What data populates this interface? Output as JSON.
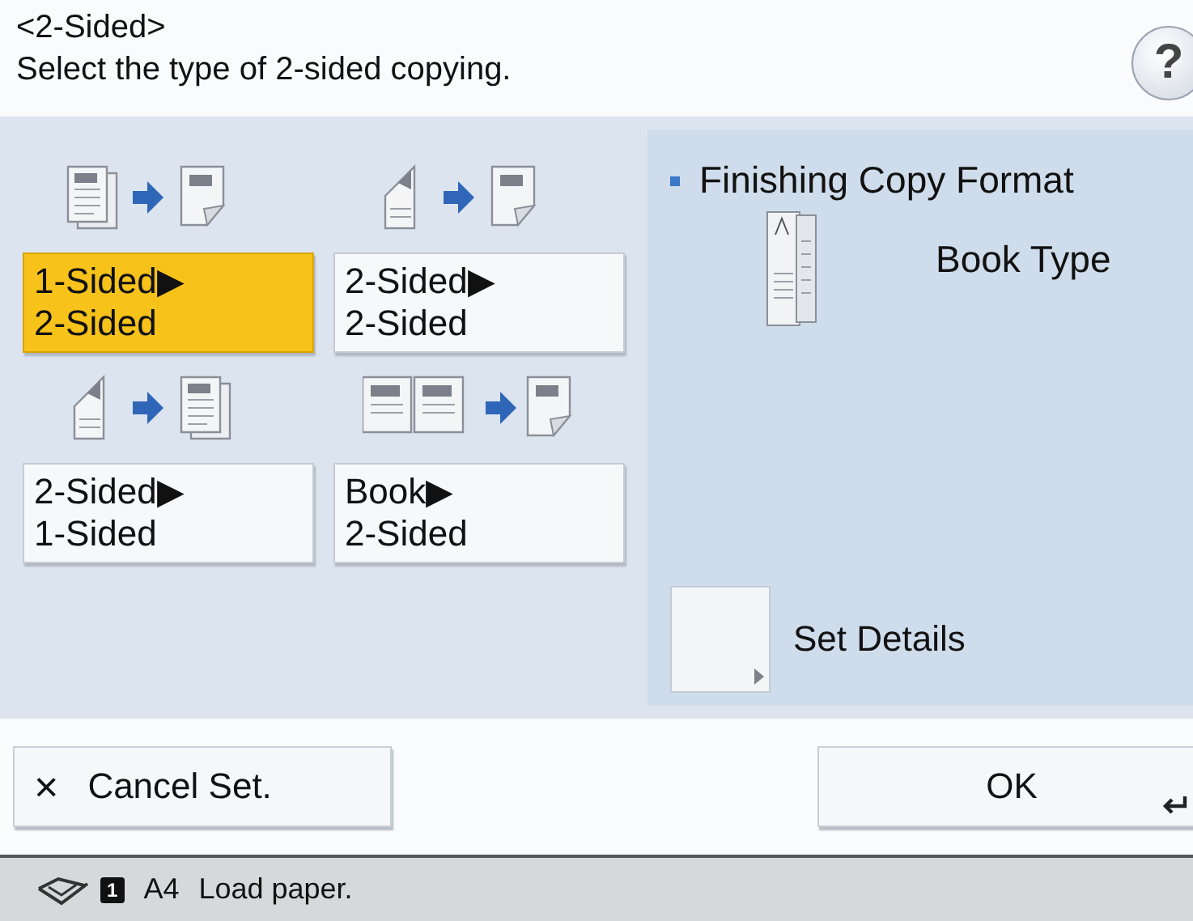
{
  "header": {
    "title": "<2-Sided>",
    "instruction": "Select the type of 2-sided copying.",
    "help": "?"
  },
  "options": [
    {
      "kind": "one-to-two",
      "lines": [
        "1-Sided▶",
        "2-Sided"
      ],
      "selected": true
    },
    {
      "kind": "two-to-two",
      "lines": [
        "2-Sided▶",
        "2-Sided"
      ],
      "selected": false
    },
    {
      "kind": "two-to-one",
      "lines": [
        "2-Sided▶",
        "1-Sided"
      ],
      "selected": false
    },
    {
      "kind": "book-to-two",
      "lines": [
        "Book▶",
        "2-Sided"
      ],
      "selected": false
    }
  ],
  "finishing": {
    "title": "Finishing Copy Format",
    "value": "Book Type",
    "details_label": "Set Details"
  },
  "buttons": {
    "cancel_icon": "×",
    "cancel": "Cancel Set.",
    "ok": "OK"
  },
  "status_bar": {
    "drawer": "1",
    "paper": "A4",
    "message": "Load paper."
  }
}
